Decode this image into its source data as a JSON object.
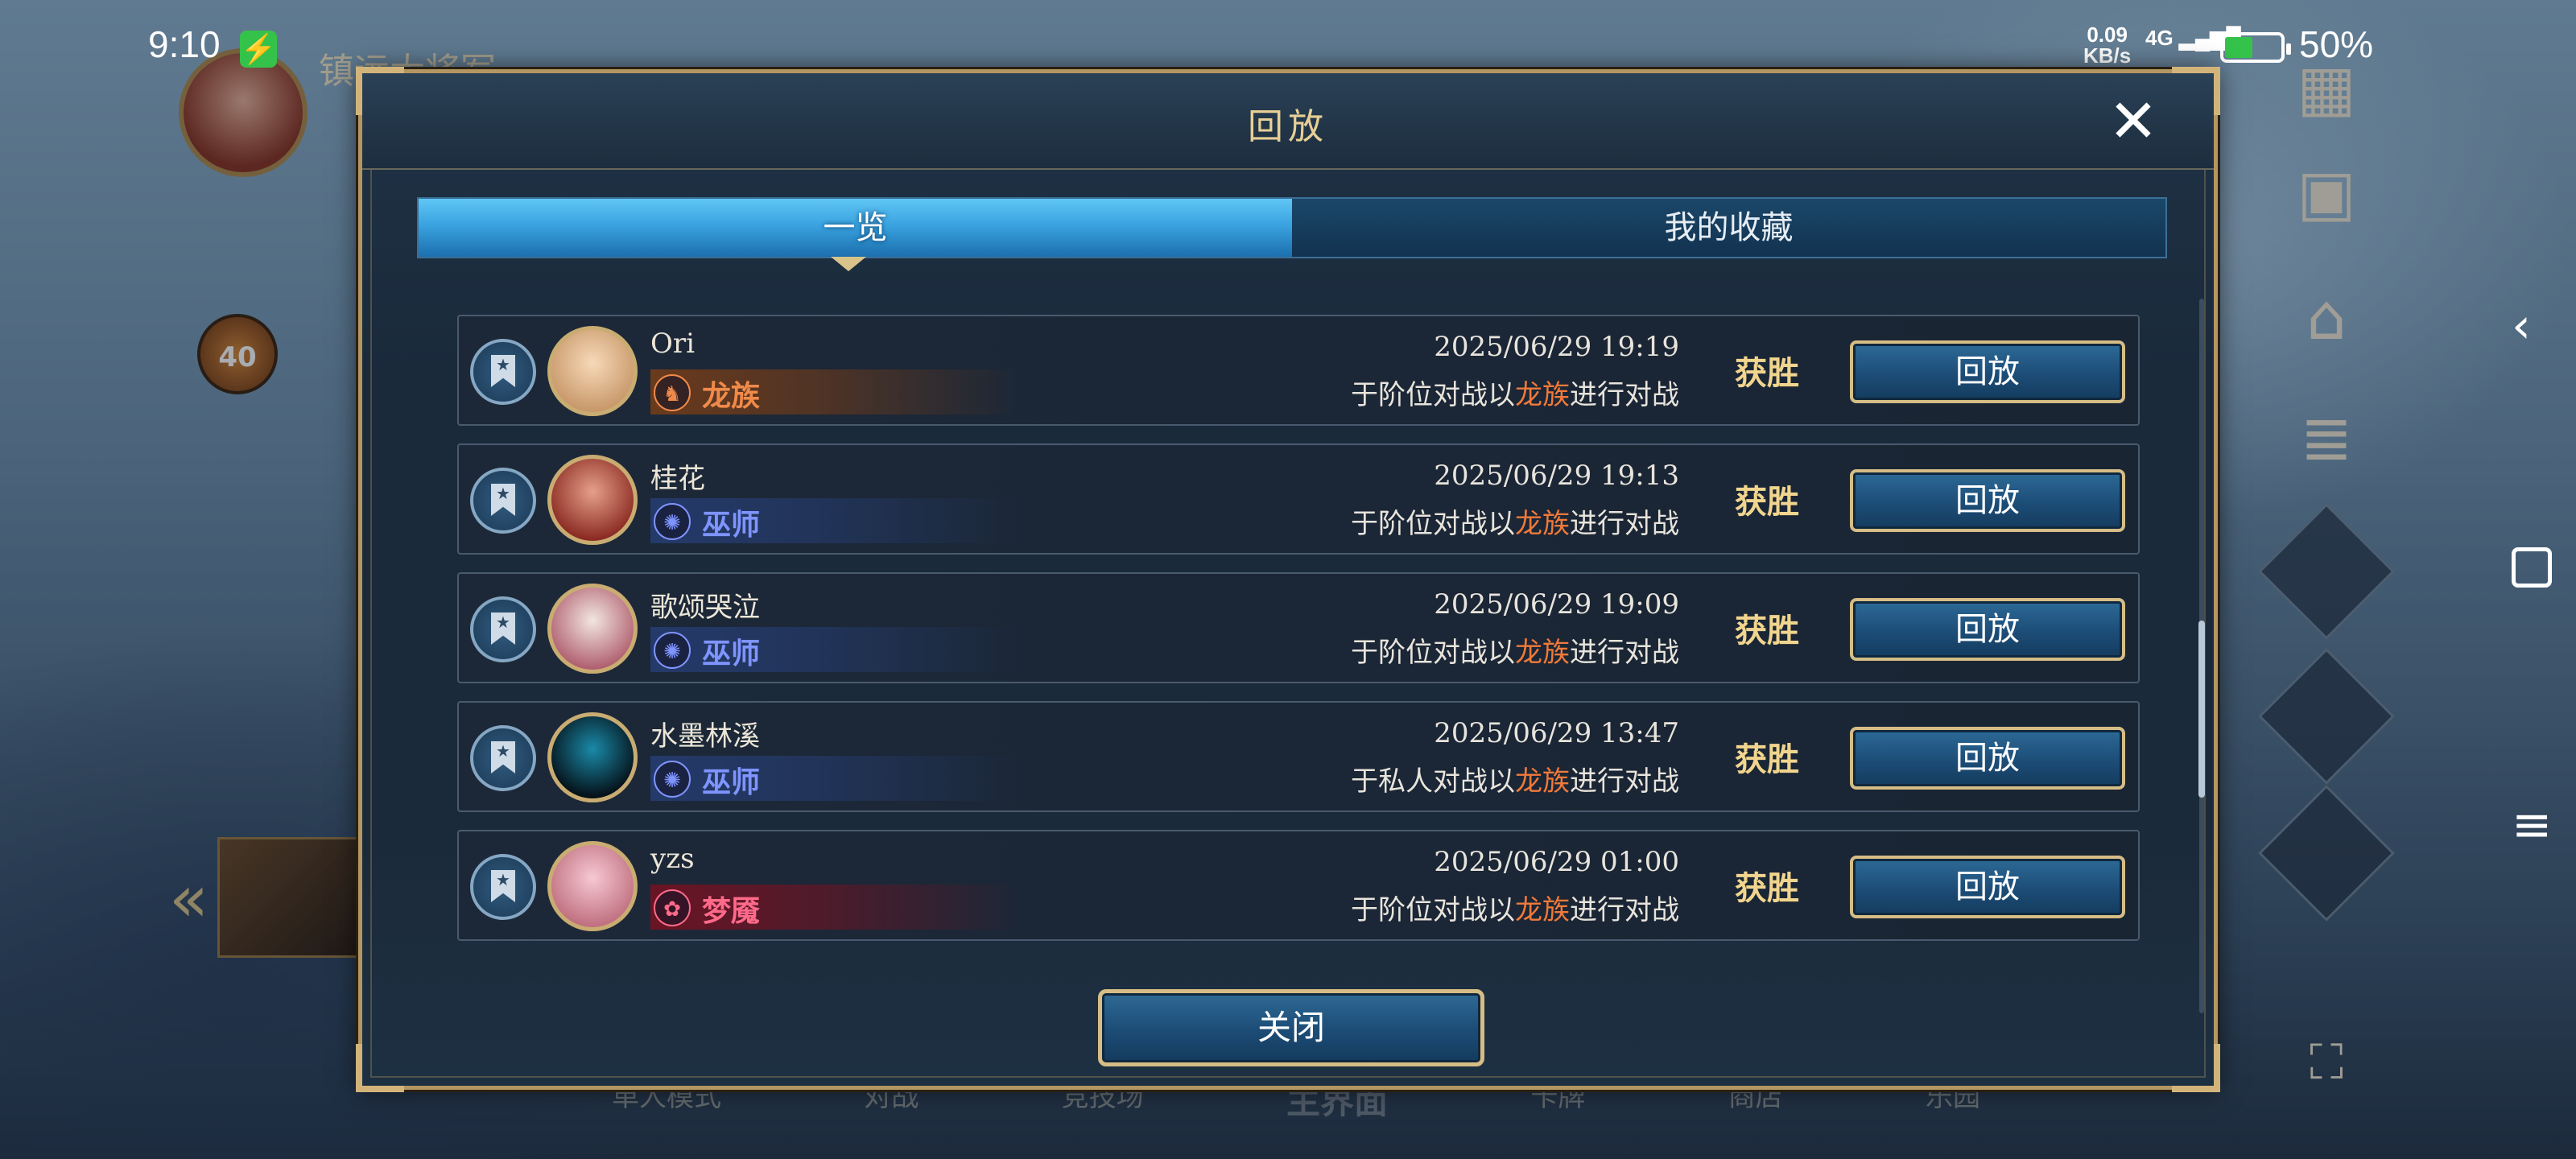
{
  "status_bar": {
    "time": "9:10",
    "net_speed": "0.09\nKB/s",
    "network_type": "4G",
    "battery_pct": "50%",
    "charging": true
  },
  "background": {
    "player_name": "镇远大将军",
    "level": "40",
    "bottom_tabs": [
      "单人模式",
      "对战",
      "竞技场",
      "主界面",
      "卡牌",
      "商店",
      "乐园"
    ]
  },
  "modal": {
    "title": "回放",
    "tabs": [
      {
        "label": "一览",
        "active": true
      },
      {
        "label": "我的收藏",
        "active": false
      }
    ],
    "rows": [
      {
        "player": "Ori",
        "class_label": "龙族",
        "class_icon": "dragon-icon",
        "class_color": "#f08a4a",
        "band_color": "#6a3a1c",
        "avatar_colors": [
          "#f7d9b8",
          "#c8986a"
        ],
        "date": "2025/06/29 19:19",
        "desc_prefix": "于阶位对战以",
        "desc_class": "龙族",
        "desc_suffix": "进行对战",
        "result": "获胜",
        "button": "回放"
      },
      {
        "player": "桂花",
        "class_label": "巫师",
        "class_icon": "rune-icon",
        "class_color": "#7f94ff",
        "band_color": "#243a6a",
        "avatar_colors": [
          "#e6a08a",
          "#8a2a22"
        ],
        "date": "2025/06/29 19:13",
        "desc_prefix": "于阶位对战以",
        "desc_class": "龙族",
        "desc_suffix": "进行对战",
        "result": "获胜",
        "button": "回放"
      },
      {
        "player": "歌颂哭泣",
        "class_label": "巫师",
        "class_icon": "rune-icon",
        "class_color": "#7f94ff",
        "band_color": "#243a6a",
        "avatar_colors": [
          "#f2e6e0",
          "#b06070"
        ],
        "date": "2025/06/29 19:09",
        "desc_prefix": "于阶位对战以",
        "desc_class": "龙族",
        "desc_suffix": "进行对战",
        "result": "获胜",
        "button": "回放"
      },
      {
        "player": "水墨林溪",
        "class_label": "巫师",
        "class_icon": "rune-icon",
        "class_color": "#7f94ff",
        "band_color": "#243a6a",
        "avatar_colors": [
          "#1a8aa8",
          "#051018"
        ],
        "date": "2025/06/29 13:47",
        "desc_prefix": "于私人对战以",
        "desc_class": "龙族",
        "desc_suffix": "进行对战",
        "result": "获胜",
        "button": "回放"
      },
      {
        "player": "yzs",
        "class_label": "梦魇",
        "class_icon": "nightmare-icon",
        "class_color": "#ff6a8a",
        "band_color": "#6a1424",
        "avatar_colors": [
          "#f6c8d2",
          "#c07080"
        ],
        "date": "2025/06/29 01:00",
        "desc_prefix": "于阶位对战以",
        "desc_class": "龙族",
        "desc_suffix": "进行对战",
        "result": "获胜",
        "button": "回放"
      }
    ],
    "close_button": "关闭"
  }
}
